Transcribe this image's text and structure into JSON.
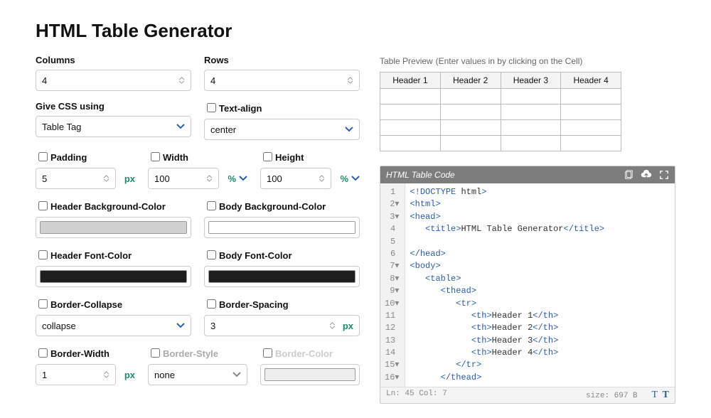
{
  "title": "HTML Table Generator",
  "form": {
    "columns": {
      "label": "Columns",
      "value": "4"
    },
    "rows": {
      "label": "Rows",
      "value": "4"
    },
    "cssUsing": {
      "label": "Give CSS using",
      "value": "Table Tag"
    },
    "textAlign": {
      "label": "Text-align",
      "value": "center",
      "checked": false
    },
    "padding": {
      "label": "Padding",
      "value": "5",
      "unit": "px",
      "checked": false
    },
    "width": {
      "label": "Width",
      "value": "100",
      "unit": "%",
      "checked": false
    },
    "height": {
      "label": "Height",
      "value": "100",
      "unit": "%",
      "checked": false
    },
    "headerBg": {
      "label": "Header Background-Color",
      "color": "#d0d0d0",
      "checked": false
    },
    "bodyBg": {
      "label": "Body Background-Color",
      "color": "#ffffff",
      "checked": false
    },
    "headerFont": {
      "label": "Header Font-Color",
      "color": "#1e1e1e",
      "checked": false
    },
    "bodyFont": {
      "label": "Body Font-Color",
      "color": "#1e1e1e",
      "checked": false
    },
    "borderCollapse": {
      "label": "Border-Collapse",
      "value": "collapse",
      "checked": false
    },
    "borderSpacing": {
      "label": "Border-Spacing",
      "value": "3",
      "unit": "px",
      "checked": false
    },
    "borderWidth": {
      "label": "Border-Width",
      "value": "1",
      "unit": "px",
      "checked": false
    },
    "borderStyle": {
      "label": "Border-Style",
      "value": "none",
      "checked": false
    },
    "borderColor": {
      "label": "Border-Color",
      "checked": false
    }
  },
  "preview": {
    "title": "Table Preview",
    "hint": "(Enter values in by clicking on the Cell)",
    "headers": [
      "Header 1",
      "Header 2",
      "Header 3",
      "Header 4"
    ]
  },
  "code": {
    "title": "HTML Table Code",
    "lines": [
      "<!DOCTYPE html>",
      "<html>",
      "<head>",
      "   <title>HTML Table Generator</title>",
      "",
      "</head>",
      "<body>",
      "   <table>",
      "      <thead>",
      "         <tr>",
      "            <th>Header 1</th>",
      "            <th>Header 2</th>",
      "            <th>Header 3</th>",
      "            <th>Header 4</th>",
      "         </tr>",
      "      </thead>"
    ],
    "status": {
      "pos": "Ln: 45 Col: 7",
      "size": "size: 697 B"
    }
  }
}
